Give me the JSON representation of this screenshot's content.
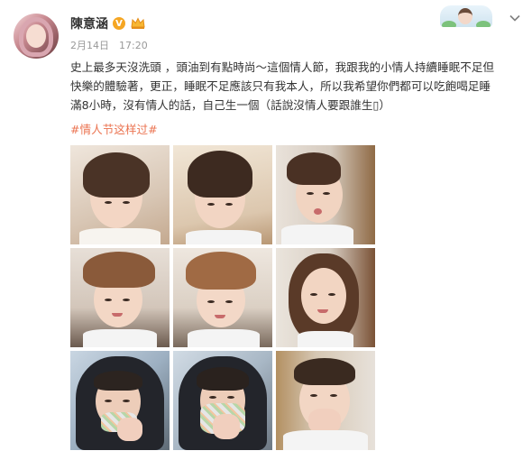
{
  "post": {
    "username": "陳意涵",
    "verified_badge": "V",
    "date": "2月14日",
    "time": "17:20",
    "text": "史上最多天沒洗頭 ，頭油到有點時尚～這個情人節，我跟我的小情人持續睡眠不足但快樂的體驗著，更正，睡眠不足應該只有我本人，所以我希望你們都可以吃飽喝足睡滿8小時，沒有情人的話，自己生一個（話說沒情人要跟誰生▯）",
    "hashtag": "#情人节这样过#"
  },
  "icons": {
    "verified": "verified-v-icon",
    "member": "crown-icon",
    "menu": "chevron-down-icon"
  },
  "colors": {
    "hashtag": "#eb7350",
    "verified": "#f5a623",
    "meta": "#999999"
  },
  "photos": [
    {
      "label": "photo-1"
    },
    {
      "label": "photo-2"
    },
    {
      "label": "photo-3"
    },
    {
      "label": "photo-4"
    },
    {
      "label": "photo-5"
    },
    {
      "label": "photo-6"
    },
    {
      "label": "photo-7"
    },
    {
      "label": "photo-8"
    },
    {
      "label": "photo-9"
    }
  ]
}
